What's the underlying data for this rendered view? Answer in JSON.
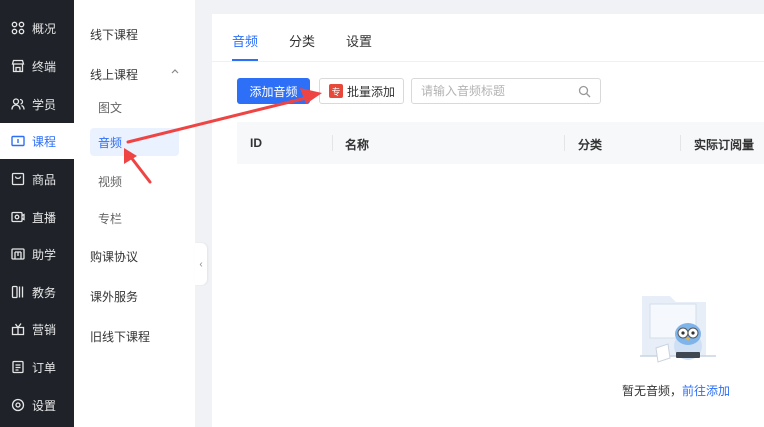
{
  "sidebar": {
    "items": [
      {
        "label": "概况",
        "icon": "dashboard-icon"
      },
      {
        "label": "终端",
        "icon": "store-icon"
      },
      {
        "label": "学员",
        "icon": "users-icon"
      },
      {
        "label": "课程",
        "icon": "course-icon",
        "active": true
      },
      {
        "label": "商品",
        "icon": "goods-icon"
      },
      {
        "label": "直播",
        "icon": "live-icon"
      },
      {
        "label": "助学",
        "icon": "study-icon"
      },
      {
        "label": "教务",
        "icon": "academic-icon"
      },
      {
        "label": "营销",
        "icon": "marketing-icon"
      },
      {
        "label": "订单",
        "icon": "order-icon"
      },
      {
        "label": "设置",
        "icon": "settings-icon"
      }
    ]
  },
  "subnav": {
    "offline": "线下课程",
    "online": "线上课程",
    "children": [
      "图文",
      "音频",
      "视频",
      "专栏"
    ],
    "agreement": "购课协议",
    "extra_service": "课外服务",
    "old_offline": "旧线下课程"
  },
  "tabs": [
    "音频",
    "分类",
    "设置"
  ],
  "toolbar": {
    "add_label": "添加音频",
    "batch_badge": "专",
    "batch_label": "批量添加",
    "search_placeholder": "请输入音频标题"
  },
  "table": {
    "columns": [
      "ID",
      "名称",
      "分类",
      "实际订阅量"
    ]
  },
  "empty": {
    "text": "暂无音频，",
    "link": "前往添加"
  },
  "colors": {
    "primary": "#2d6ff7",
    "sidebar_bg": "#1f2329",
    "badge_red": "#e8483a",
    "arrow_red": "#ef4444"
  }
}
